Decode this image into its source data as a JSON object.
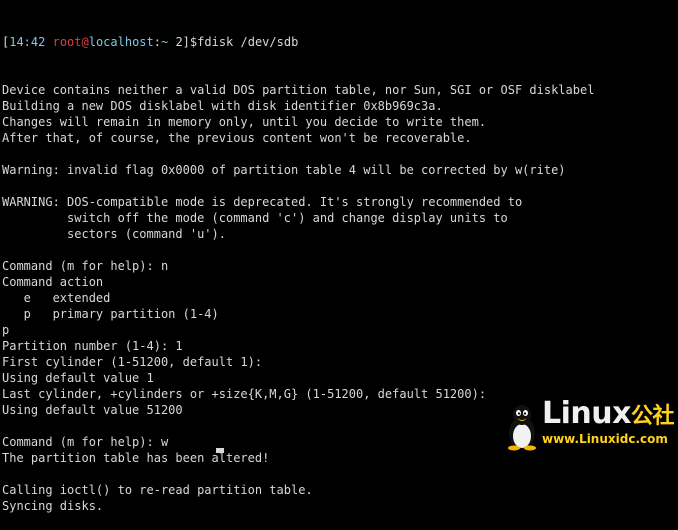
{
  "prompt": {
    "open": "[",
    "time": "14:42",
    "user": "root",
    "at": "@",
    "host": "localhost",
    "sep": ":",
    "path": "~",
    "num": " 2]",
    "dollar": "$",
    "command": "fdisk /dev/sdb"
  },
  "output_lines": [
    "Device contains neither a valid DOS partition table, nor Sun, SGI or OSF disklabel",
    "Building a new DOS disklabel with disk identifier 0x8b969c3a.",
    "Changes will remain in memory only, until you decide to write them.",
    "After that, of course, the previous content won't be recoverable.",
    "",
    "Warning: invalid flag 0x0000 of partition table 4 will be corrected by w(rite)",
    "",
    "WARNING: DOS-compatible mode is deprecated. It's strongly recommended to",
    "         switch off the mode (command 'c') and change display units to",
    "         sectors (command 'u').",
    "",
    "Command (m for help): n",
    "Command action",
    "   e   extended",
    "   p   primary partition (1-4)",
    "p",
    "Partition number (1-4): 1",
    "First cylinder (1-51200, default 1):",
    "Using default value 1",
    "Last cylinder, +cylinders or +size{K,M,G} (1-51200, default 51200):",
    "Using default value 51200",
    "",
    "Command (m for help): w",
    "The partition table has been altered!",
    "",
    "Calling ioctl() to re-read partition table.",
    "Syncing disks."
  ],
  "watermark": {
    "title": "Linux",
    "title_cn": "公社",
    "url": "www.Linuxidc.com"
  },
  "colors": {
    "background": "#000000",
    "text": "#d8d8d8",
    "prompt_user": "#e03c3c",
    "prompt_host": "#7ec8e8",
    "watermark_accent": "#ffd21e"
  }
}
